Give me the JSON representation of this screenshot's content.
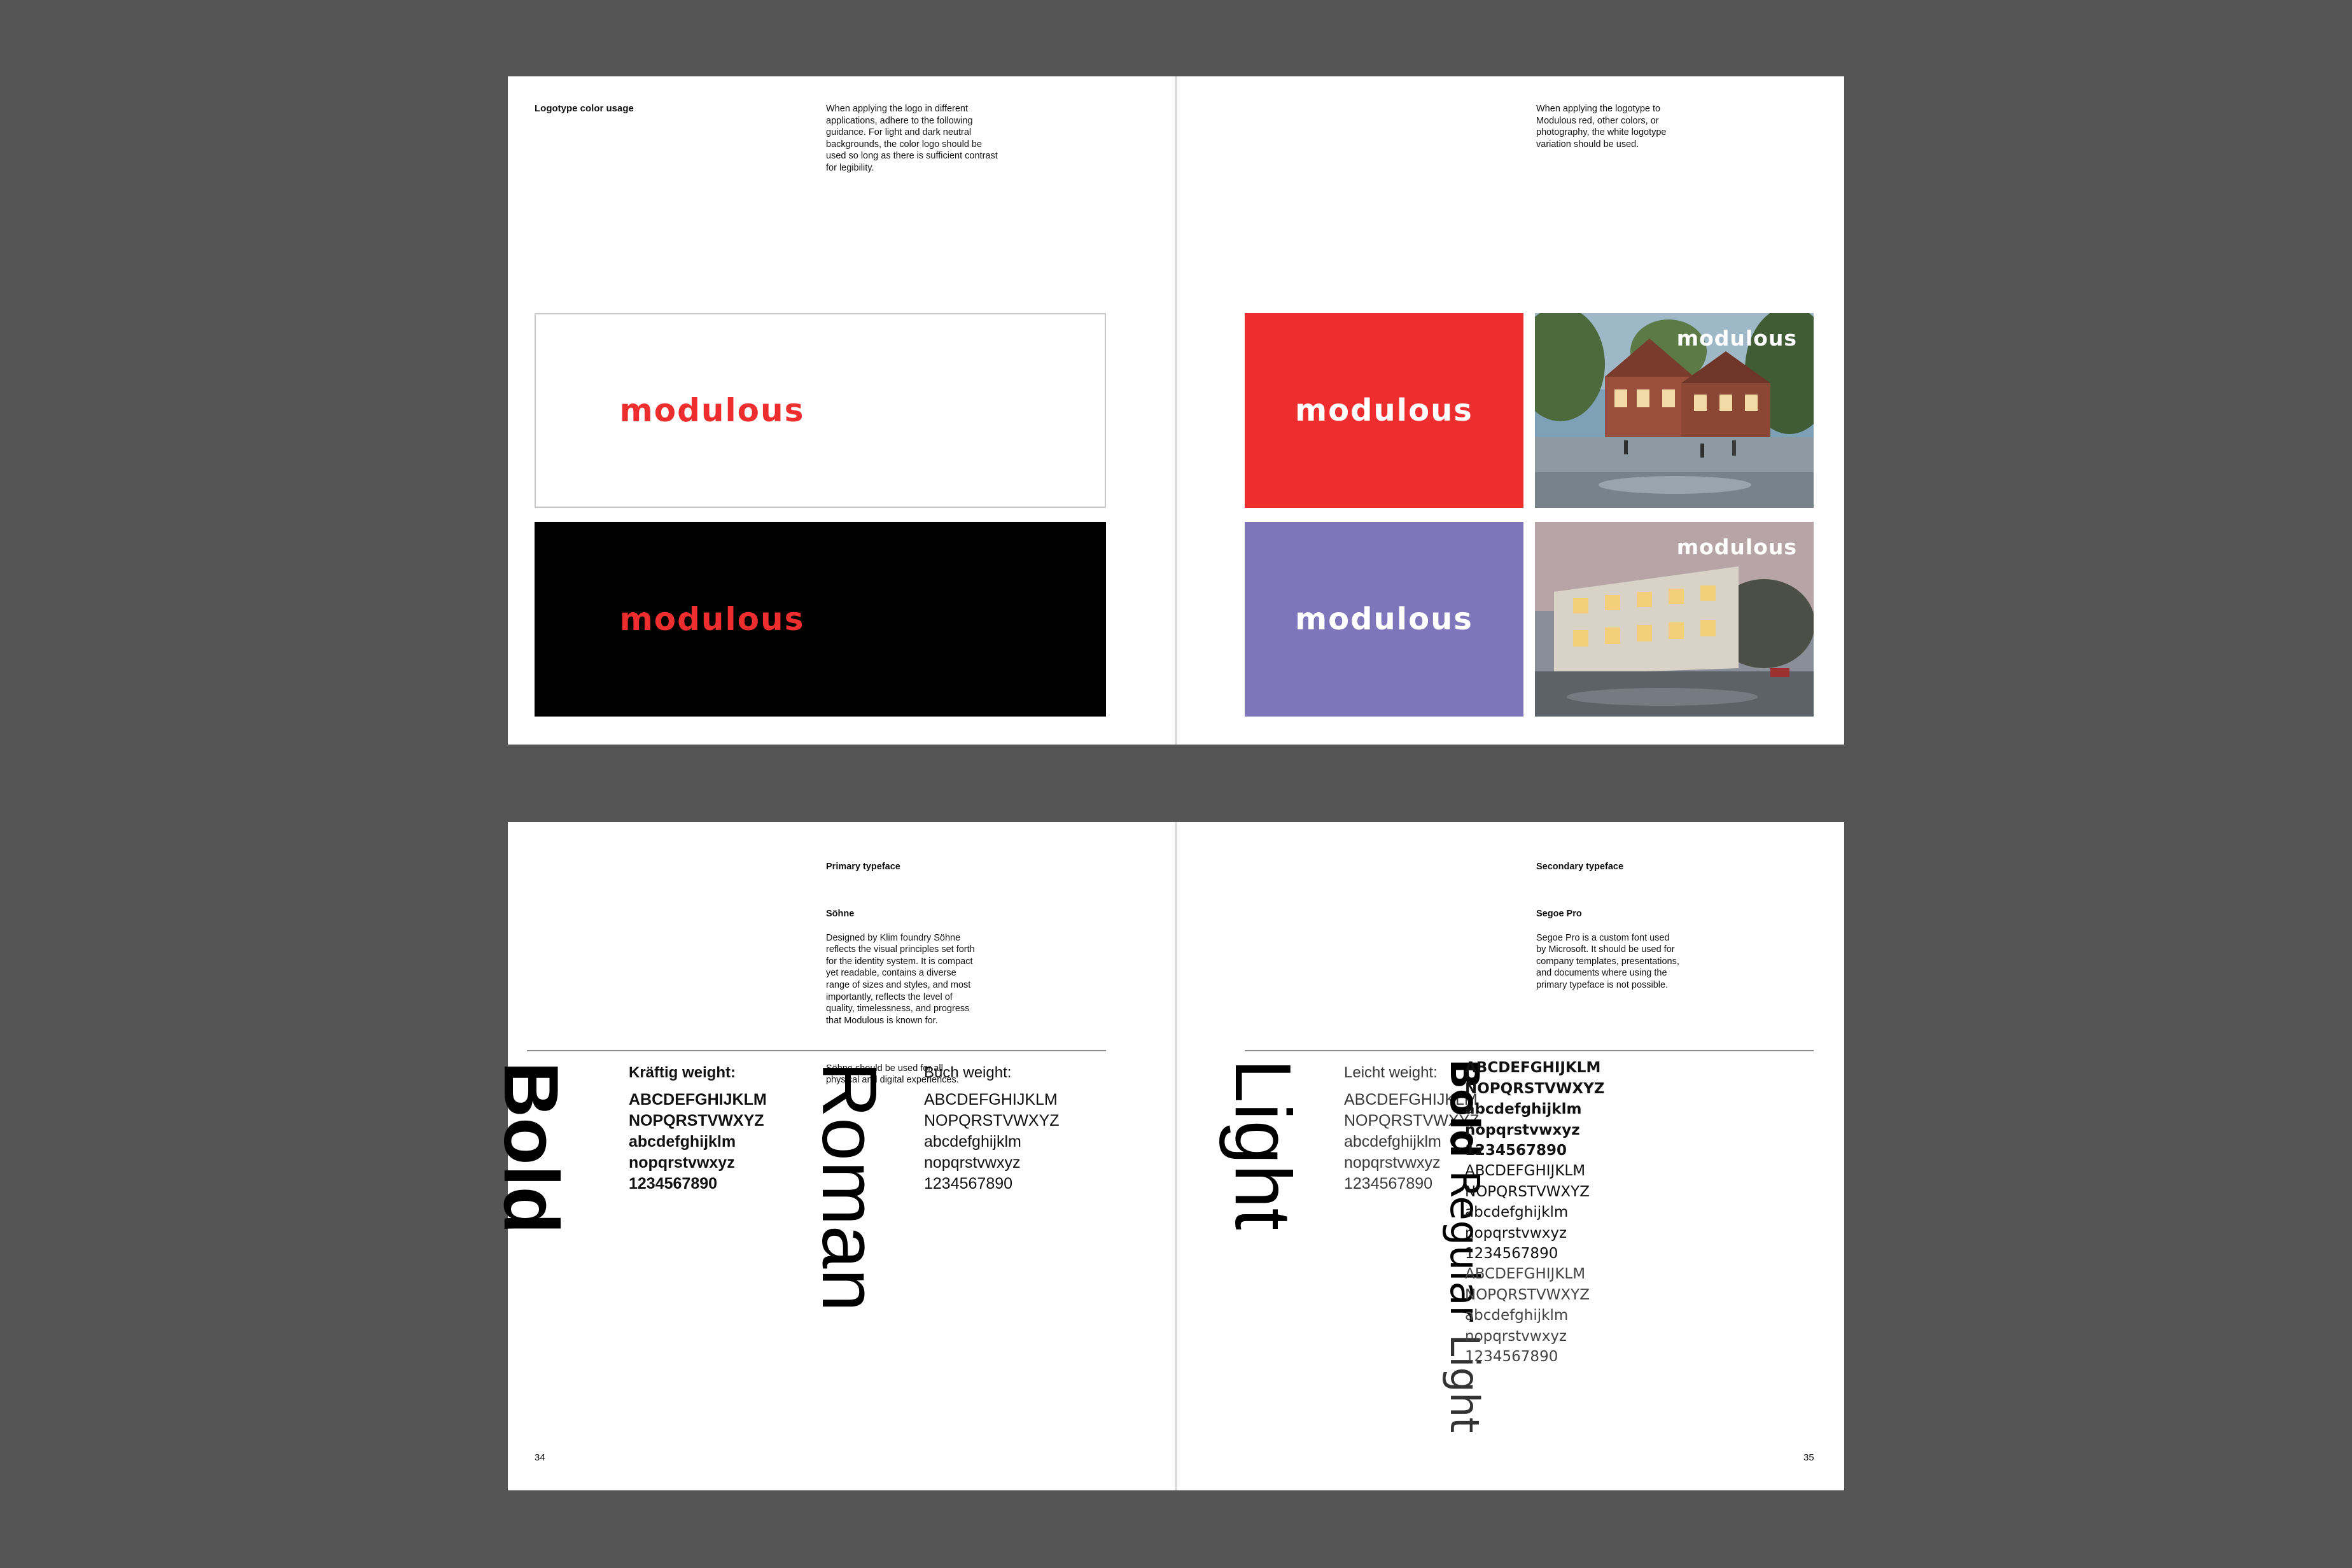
{
  "colors": {
    "background": "#555555",
    "modulous_red": "#ee2e2e",
    "modulous_purple": "#7e75ba",
    "black": "#000000",
    "white": "#ffffff"
  },
  "spread_top": {
    "left_page": {
      "label": "Logotype color usage",
      "body": "When applying the logo in different\napplications, adhere to the following\nguidance. For light and dark neutral\nbackgrounds, the color logo should be\nused so long as there is sufficient contrast\nfor legibility.",
      "logos": [
        {
          "wordmark": "modulous",
          "background": "white",
          "logo_color": "red"
        },
        {
          "wordmark": "modulous",
          "background": "black",
          "logo_color": "red"
        }
      ]
    },
    "right_page": {
      "body": "When applying the logotype to\nModulous red, other colors, or\nphotography, the white logotype\nvariation should be used.",
      "logos": [
        {
          "wordmark": "modulous",
          "background": "red",
          "logo_color": "white"
        },
        {
          "wordmark": "modulous",
          "background": "photo-housing-street",
          "logo_color": "white"
        },
        {
          "wordmark": "modulous",
          "background": "purple",
          "logo_color": "white"
        },
        {
          "wordmark": "modulous",
          "background": "photo-apartments-dusk",
          "logo_color": "white"
        }
      ]
    }
  },
  "spread_bottom": {
    "left_page": {
      "label": "Primary typeface",
      "font_name": "Söhne",
      "body": "Designed by Klim foundry Söhne\nreflects the visual principles set forth\nfor the identity system. It is compact\nyet readable, contains a diverse\nrange of sizes and styles, and most\nimportantly, reflects the level of\nquality, timelessness, and progress\nthat Modulous is known for.",
      "body2": " Söhne should be used for all\nphysical and digital experiences.",
      "specimens": [
        {
          "big": "Bold",
          "title": "Kräftig weight:",
          "lines": "ABCDEFGHIJKLM\nNOPQRSTVWXYZ\nabcdefghijklm\nnopqrstvwxyz\n1234567890"
        },
        {
          "big": "Roman",
          "title": "Buch weight:",
          "lines": "ABCDEFGHIJKLM\nNOPQRSTVWXYZ\nabcdefghijklm\nnopqrstvwxyz\n1234567890"
        }
      ],
      "page_number": "34"
    },
    "right_page": {
      "label": "Secondary typeface",
      "font_name": "Segoe Pro",
      "body": "Segoe Pro is a custom font used\nby Microsoft. It should be used for\ncompany templates, presentations,\nand documents where using the\nprimary typeface is not possible.",
      "light_specimen": {
        "big": "Light",
        "title": "Leicht weight:",
        "lines": "ABCDEFGHIJKLM\nNOPQRSTVWXYZ\nabcdefghijklm\nnopqrstvwxyz\n1234567890"
      },
      "segoe_big": {
        "bold": "Bold",
        "regular": "Regular",
        "light": "Light"
      },
      "segoe_bold_lines": "ABCDEFGHIJKLM\nNOPQRSTVWXYZ\nabcdefghijklm\nnopqrstvwxyz\n1234567890",
      "segoe_regular_lines": "ABCDEFGHIJKLM\nNOPQRSTVWXYZ\nabcdefghijklm\nnopqrstvwxyz\n1234567890",
      "segoe_light_lines": "ABCDEFGHIJKLM\nNOPQRSTVWXYZ\nabcdefghijklm\nnopqrstvwxyz\n1234567890",
      "page_number": "35"
    }
  }
}
